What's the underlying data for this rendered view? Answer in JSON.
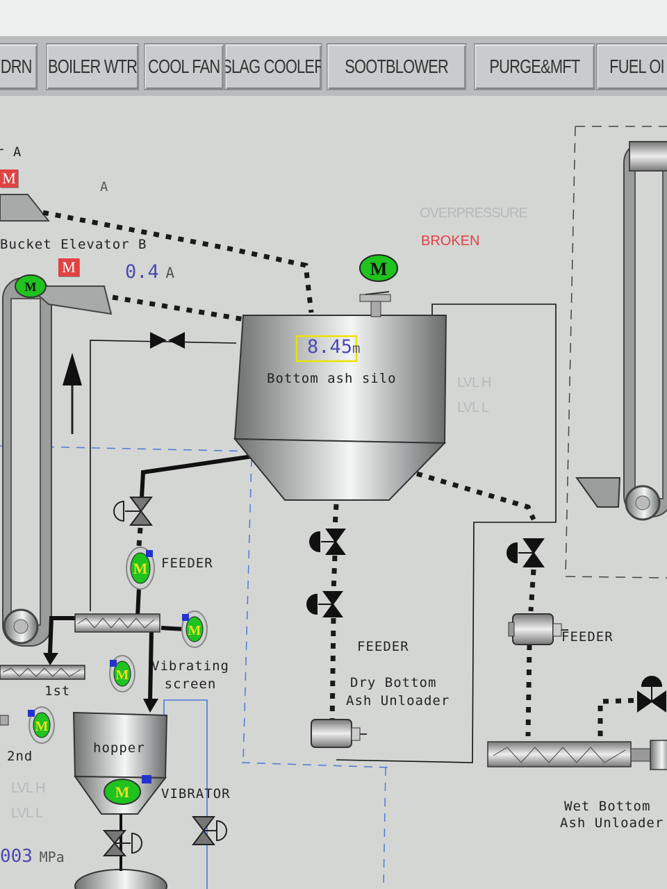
{
  "tabs": [
    {
      "label": "DRN"
    },
    {
      "label": "BOILER WTR"
    },
    {
      "label": "COOL FAN"
    },
    {
      "label": "SLAG COOLER"
    },
    {
      "label": "SOOTBLOWER"
    },
    {
      "label": "PURGE&MFT"
    },
    {
      "label": "FUEL OI"
    }
  ],
  "elevators": {
    "a_label": "r A",
    "a_current_label": "A",
    "b_label": "Bucket Elevator B",
    "b_current_value": "0.4",
    "b_current_unit": "A",
    "motor_box_label": "M"
  },
  "silo": {
    "name": "Bottom ash silo",
    "level_value": "8.45",
    "level_unit": "m",
    "lvl_high": "LVL H",
    "lvl_low": "LVL L",
    "status_overpressure": "OVERPRESSURE",
    "status_broken": "BROKEN",
    "motor_label": "M"
  },
  "left_branch": {
    "feeder_label": "FEEDER",
    "vibrating_screen_label": "Vibrating\nscreen",
    "first_label": "1st",
    "second_label": "2nd",
    "hopper_label": "hopper",
    "vibrator_label": "VIBRATOR",
    "hopper_lvl_high": "LVL H",
    "hopper_lvl_low": "LVL L",
    "pressure_value": "003",
    "pressure_unit": "MPa",
    "motor_label": "M"
  },
  "dry_unloader": {
    "feeder_label": "FEEDER",
    "name_line1": "Dry Bottom",
    "name_line2": "Ash Unloader"
  },
  "wet_unloader": {
    "feeder_label": "FEEDER",
    "name_line1": "Wet Bottom",
    "name_line2": "Ash Unloader"
  },
  "colors": {
    "background": "#d4d6d4",
    "motor_green": "#1fc21f",
    "motor_yellow_m": "#e8e020",
    "alarm_red": "#e04242",
    "level_frame": "#e8e400",
    "value_blue": "#4a4ab0"
  }
}
